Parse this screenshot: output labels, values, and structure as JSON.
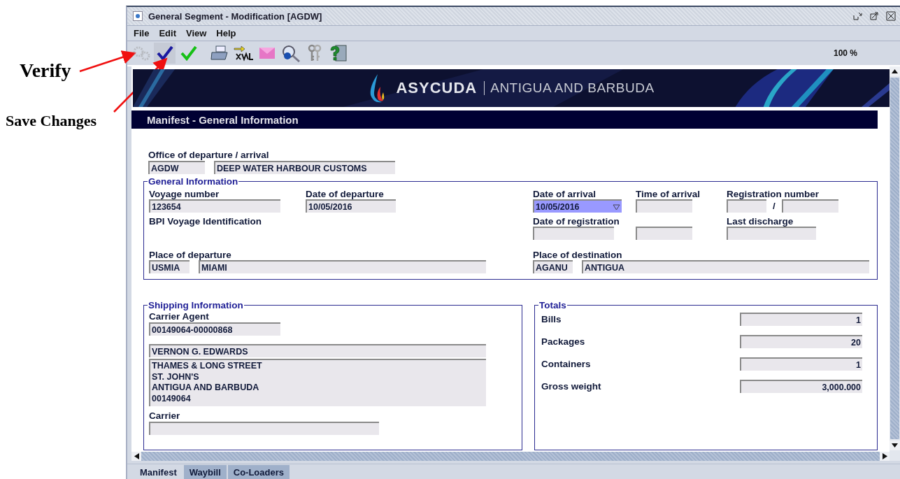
{
  "annotations": [
    {
      "text": "Verify"
    },
    {
      "text": "Save Changes"
    }
  ],
  "window": {
    "title": "General Segment - Modification [AGDW]"
  },
  "menu": [
    "File",
    "Edit",
    "View",
    "Help"
  ],
  "toolbar": {
    "buttons": [
      {
        "kind": "gears",
        "disabled": true
      },
      {
        "kind": "save",
        "disabled": false
      },
      {
        "kind": "check",
        "disabled": false
      },
      {
        "kind": "print",
        "disabled": false
      },
      {
        "kind": "xml",
        "disabled": false
      },
      {
        "kind": "envelope",
        "disabled": false
      },
      {
        "kind": "search",
        "disabled": false
      },
      {
        "kind": "keys",
        "disabled": false
      },
      {
        "kind": "help",
        "disabled": false
      }
    ],
    "zoom": "100 %"
  },
  "banner": {
    "brand": "ASYCUDA",
    "country": "ANTIGUA AND BARBUDA"
  },
  "section_title": "Manifest - General Information",
  "office": {
    "label": "Office of departure / arrival",
    "code": "AGDW",
    "name": "DEEP WATER HARBOUR CUSTOMS"
  },
  "general_information": {
    "title": "General Information",
    "voyage_number": {
      "label": "Voyage number",
      "value": "123654"
    },
    "date_of_departure": {
      "label": "Date of departure",
      "value": "10/05/2016"
    },
    "bpi_label": "BPI Voyage Identification",
    "place_of_departure": {
      "label": "Place of departure",
      "code": "USMIA",
      "name": "MIAMI"
    },
    "date_of_arrival": {
      "label": "Date of arrival",
      "value": "10/05/2016",
      "focused": true
    },
    "time_of_arrival": {
      "label": "Time of arrival"
    },
    "registration_number": {
      "label": "Registration number",
      "separator": "/"
    },
    "date_of_registration": {
      "label": "Date of registration"
    },
    "last_discharge": {
      "label": "Last discharge"
    },
    "place_of_destination": {
      "label": "Place of destination",
      "code": "AGANU",
      "name": "ANTIGUA"
    }
  },
  "shipping_information": {
    "title": "Shipping Information",
    "carrier_agent": {
      "label": "Carrier Agent",
      "value": "00149064-00000868"
    },
    "agent_name": "VERNON G. EDWARDS",
    "agent_address": [
      "THAMES & LONG STREET",
      "ST. JOHN'S",
      "ANTIGUA AND BARBUDA",
      "00149064"
    ],
    "carrier": {
      "label": "Carrier"
    }
  },
  "totals": {
    "title": "Totals",
    "rows": [
      {
        "label": "Bills",
        "value": "1"
      },
      {
        "label": "Packages",
        "value": "20"
      },
      {
        "label": "Containers",
        "value": "1"
      },
      {
        "label": "Gross weight",
        "value": "3,000.000"
      }
    ]
  },
  "tabs": [
    {
      "label": "Manifest",
      "selected": true
    },
    {
      "label": "Waybill",
      "selected": false
    },
    {
      "label": "Co-Loaders",
      "selected": false
    }
  ]
}
